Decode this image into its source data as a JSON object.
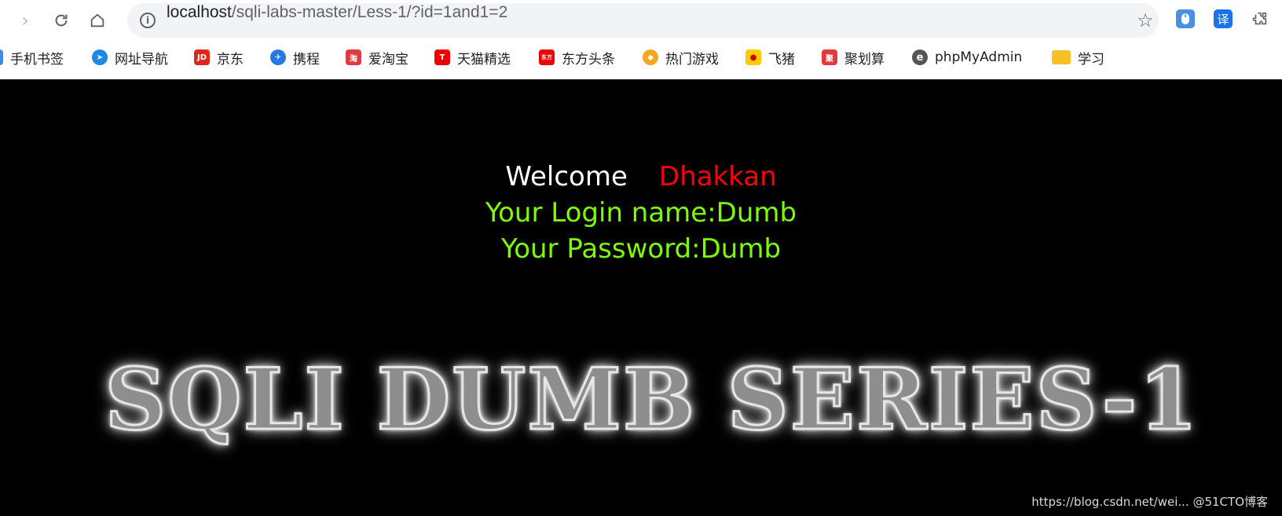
{
  "browser": {
    "url_host": "localhost",
    "url_path": "/sqli-labs-master/Less-1/?id=1and1=2",
    "extensions": [
      {
        "icon": "mouse-extension-icon",
        "color": "#4a90e2"
      },
      {
        "icon": "translate-extension-icon",
        "glyph": "译",
        "color": "#1a73e8"
      },
      {
        "icon": "puzzle-extensions-icon",
        "color": "#5f6368"
      }
    ]
  },
  "bookmarks": [
    {
      "label": "手机书签",
      "icon": "folder-icon",
      "color": "#4285f4"
    },
    {
      "label": "网址导航",
      "icon": "compass-icon",
      "color": "#1e88e5"
    },
    {
      "label": "京东",
      "icon": "jd-icon",
      "glyph": "JD",
      "color": "#e1251b"
    },
    {
      "label": "携程",
      "icon": "ctrip-icon",
      "color": "#2577e3"
    },
    {
      "label": "爱淘宝",
      "icon": "taobao-icon",
      "glyph": "淘",
      "color": "#e4393c"
    },
    {
      "label": "天猫精选",
      "icon": "tmall-icon",
      "glyph": "T",
      "color": "#e00"
    },
    {
      "label": "东方头条",
      "icon": "dongfang-icon",
      "glyph": "东方",
      "color": "#e00"
    },
    {
      "label": "热门游戏",
      "icon": "game-icon",
      "color": "#f5a623"
    },
    {
      "label": "飞猪",
      "icon": "fliggy-icon",
      "color": "#ffcc00"
    },
    {
      "label": "聚划算",
      "icon": "juhuasuan-icon",
      "glyph": "聚",
      "color": "#e4393c"
    },
    {
      "label": "phpMyAdmin",
      "icon": "phpmyadmin-icon",
      "glyph": "e",
      "color": "#555"
    },
    {
      "label": "学习",
      "icon": "folder-icon",
      "color": "#f6c026"
    }
  ],
  "page": {
    "welcome": "Welcome",
    "user": "Dhakkan",
    "login_line": "Your Login name:Dumb",
    "password_line": "Your Password:Dumb",
    "banner": "SQLI DUMB SERIES-1",
    "watermark": "https://blog.csdn.net/wei... @51CTO博客"
  }
}
